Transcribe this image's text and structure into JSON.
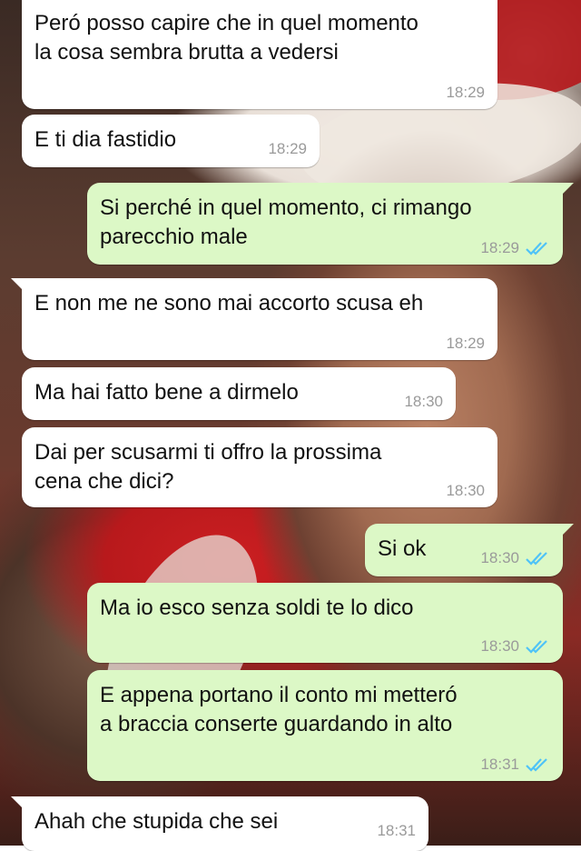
{
  "messages": [
    {
      "id": "m1",
      "direction": "incoming",
      "text": "Peró posso capire che in quel momento\nla cosa sembra brutta a vedersi",
      "time": "18:29",
      "status": null
    },
    {
      "id": "m2",
      "direction": "incoming",
      "text": "E ti dia fastidio",
      "time": "18:29",
      "status": null
    },
    {
      "id": "m3",
      "direction": "outgoing",
      "text": "Si perché in quel momento, ci rimango\nparecchio male",
      "time": "18:29",
      "status": "read"
    },
    {
      "id": "m4",
      "direction": "incoming",
      "text": "E non me ne sono mai accorto scusa eh",
      "time": "18:29",
      "status": null
    },
    {
      "id": "m5",
      "direction": "incoming",
      "text": "Ma hai fatto bene a dirmelo",
      "time": "18:30",
      "status": null
    },
    {
      "id": "m6",
      "direction": "incoming",
      "text": "Dai per scusarmi ti offro la prossima\ncena che dici?",
      "time": "18:30",
      "status": null
    },
    {
      "id": "m7",
      "direction": "outgoing",
      "text": "Si ok",
      "time": "18:30",
      "status": "read"
    },
    {
      "id": "m8",
      "direction": "outgoing",
      "text": "Ma io esco senza soldi te lo dico",
      "time": "18:30",
      "status": "read"
    },
    {
      "id": "m9",
      "direction": "outgoing",
      "text": "E appena portano il conto mi metteró\na braccia conserte guardando in alto",
      "time": "18:31",
      "status": "read"
    },
    {
      "id": "m10",
      "direction": "incoming",
      "text": "Ahah che stupida che sei",
      "time": "18:31",
      "status": null
    }
  ],
  "colors": {
    "incoming_bubble": "#ffffff",
    "outgoing_bubble": "#dcf8c6",
    "timestamp": "#9a9a9a",
    "read_ticks": "#4fc3f7"
  },
  "icons": {
    "read_receipt": "double-check-icon"
  }
}
